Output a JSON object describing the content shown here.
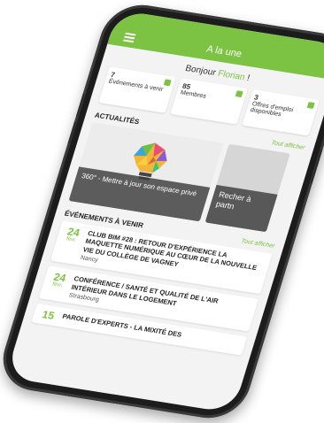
{
  "header": {
    "title": "A la une"
  },
  "greeting": {
    "prefix": "Bonjour",
    "name": "Florian",
    "suffix": "!"
  },
  "stats": [
    {
      "value": "7",
      "label": "Événements à venir"
    },
    {
      "value": "85",
      "label": "Membres"
    },
    {
      "value": "3",
      "label": "Offres d'emploi disponibles"
    }
  ],
  "news": {
    "heading": "ACTUALITÉS",
    "see_all": "Tout afficher",
    "items": [
      {
        "caption": "360° - Mettre à jour son espace privé"
      },
      {
        "caption": "Recher à partn"
      }
    ]
  },
  "events": {
    "heading": "ÉVÉNEMENTS À VENIR",
    "see_all": "Tout afficher",
    "items": [
      {
        "day": "24",
        "month": "févr.",
        "title": "CLUB BIM #28 : RETOUR D'EXPÉRIENCE LA MAQUETTE NUMÉRIQUE AU CŒUR DE LA NOUVELLE VIE DU COLLÈGE DE VAGNEY",
        "location": "Nancy"
      },
      {
        "day": "24",
        "month": "févr.",
        "title": "CONFÉRENCE / SANTÉ ET QUALITÉ DE L'AIR INTÉRIEUR DANS LE LOGEMENT",
        "location": "Strasbourg"
      },
      {
        "day": "15",
        "month": "",
        "title": "PAROLE D'EXPERTS - LA MIXITÉ DES",
        "location": ""
      }
    ]
  },
  "colors": {
    "accent": "#7cc243",
    "caption_bg": "#3c3c3c"
  }
}
